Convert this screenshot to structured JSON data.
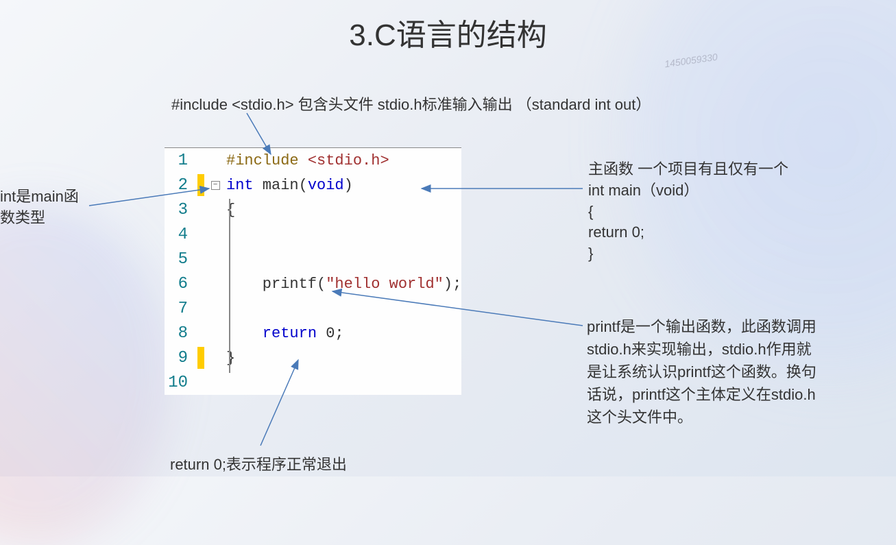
{
  "title": "3.C语言的结构",
  "watermark": "1450059330",
  "annotations": {
    "include": "#include <stdio.h>    包含头文件  stdio.h标准输入输出 （standard int out）",
    "int_main_line1": "int是main函",
    "int_main_line2": "数类型",
    "main_func_line1": "主函数  一个项目有且仅有一个",
    "main_func_line2": "int main（void）",
    "main_func_line3": "{",
    "main_func_line4": "return 0;",
    "main_func_line5": "}",
    "printf_line1": "printf是一个输出函数，此函数调用",
    "printf_line2": "stdio.h来实现输出，stdio.h作用就",
    "printf_line3": "是让系统认识printf这个函数。换句",
    "printf_line4": "话说，printf这个主体定义在stdio.h",
    "printf_line5": "这个头文件中。",
    "return": "return 0;表示程序正常退出"
  },
  "code": {
    "line1_preproc": "#include ",
    "line1_header": "<stdio.h>",
    "line2_int": "int",
    "line2_main": " main(",
    "line2_void": "void",
    "line2_close": ")",
    "line3": "{",
    "line6_printf": "    printf(",
    "line6_str": "\"hello world\"",
    "line6_end": ");",
    "line8_return": "    return",
    "line8_zero": " 0;",
    "line9": "}",
    "lineno1": "1",
    "lineno2": "2",
    "lineno3": "3",
    "lineno4": "4",
    "lineno5": "5",
    "lineno6": "6",
    "lineno7": "7",
    "lineno8": "8",
    "lineno9": "9",
    "lineno10": "10",
    "fold_minus": "−"
  }
}
